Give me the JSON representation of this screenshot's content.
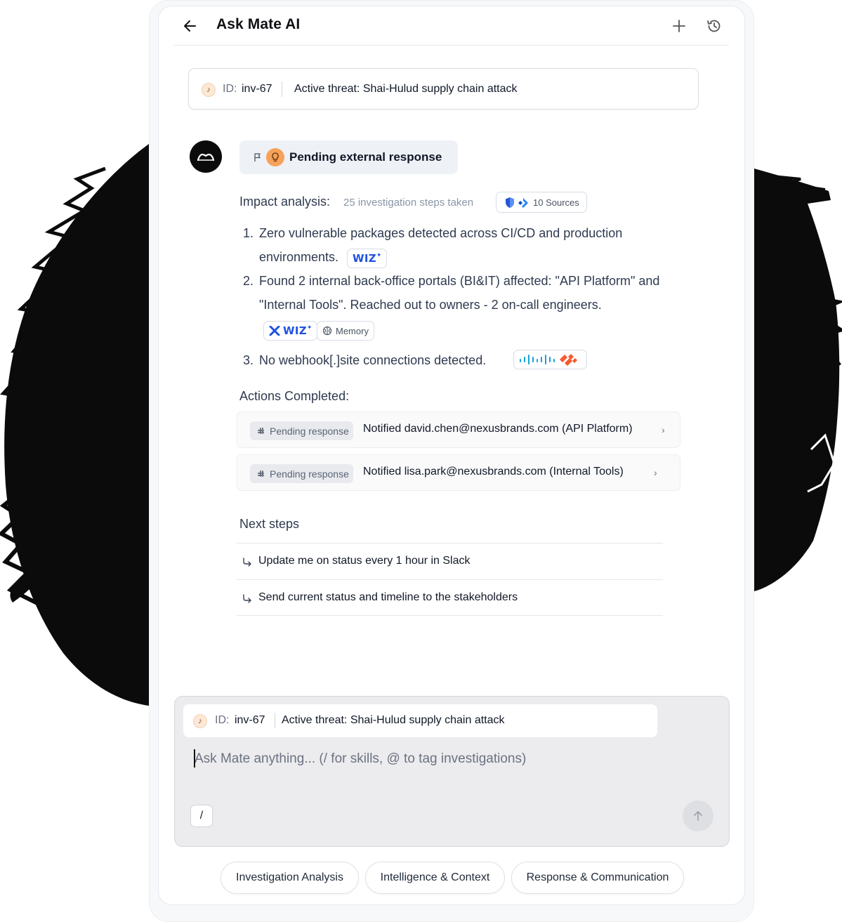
{
  "header": {
    "title": "Ask Mate AI"
  },
  "context": {
    "id_label": "ID:",
    "id_value": "inv-67",
    "title": "Active threat: Shai-Hulud supply chain attack"
  },
  "status": {
    "label": "Pending external response"
  },
  "impact": {
    "label": "Impact analysis:",
    "steps": "25 investigation steps taken",
    "sources": "10 Sources",
    "findings": [
      {
        "num": "1.",
        "text": "Zero vulnerable packages detected across CI/CD and production environments."
      },
      {
        "num": "2.",
        "text": "Found 2 internal back-office portals (BI&IT) affected: \"API Platform\" and \"Internal Tools\". Reached out to owners - 2 on-call engineers."
      },
      {
        "num": "3.",
        "text": "No webhook[.]site connections detected."
      }
    ],
    "chips": {
      "wiz": "WIZ",
      "memory": "Memory"
    }
  },
  "actions": {
    "label": "Actions Completed:",
    "items": [
      {
        "badge": "Pending response",
        "text": "Notified david.chen@nexusbrands.com (API Platform)"
      },
      {
        "badge": "Pending response",
        "text": "Notified lisa.park@nexusbrands.com (Internal Tools)"
      }
    ]
  },
  "next_steps": {
    "label": "Next steps",
    "items": [
      {
        "text": "Update me on status every 1 hour in Slack"
      },
      {
        "text": "Send current status and timeline to the stakeholders"
      }
    ]
  },
  "composer": {
    "placeholder": "Ask Mate anything... (/ for skills, @ to tag investigations)",
    "slash": "/"
  },
  "suggestions": [
    "Investigation Analysis",
    "Intelligence & Context",
    "Response & Communication"
  ],
  "colors": {
    "accent_orange": "#f7a25a",
    "wiz_blue": "#2152e3",
    "ink": "#0b0b0c"
  }
}
